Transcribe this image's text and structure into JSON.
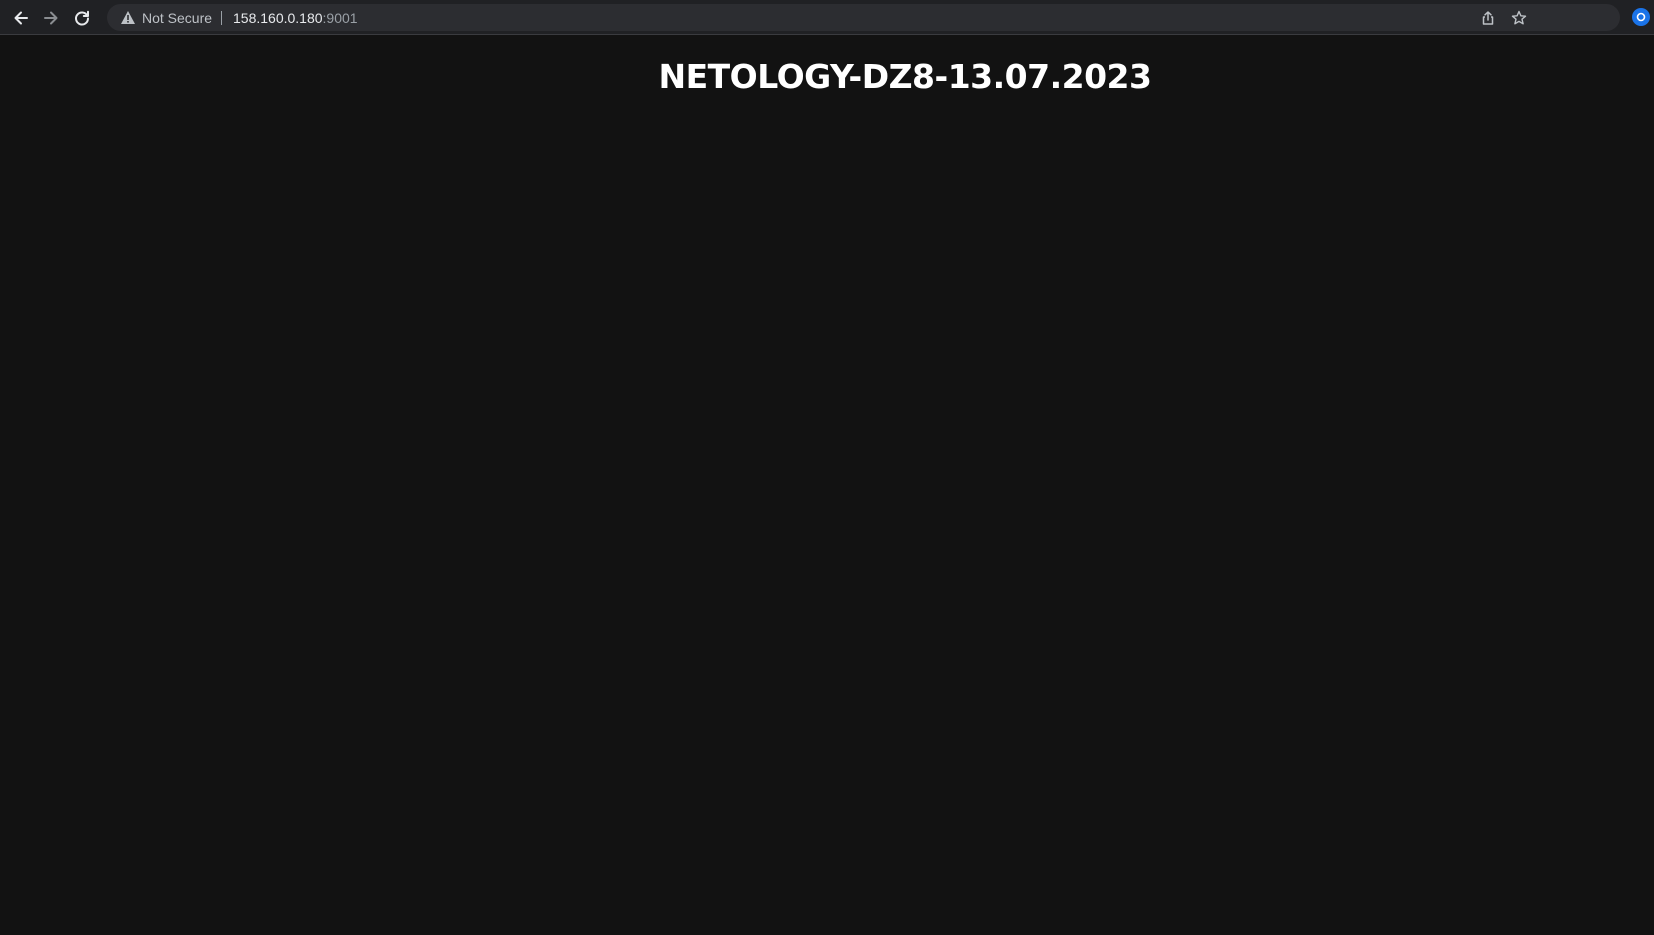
{
  "browser": {
    "security_label": "Not Secure",
    "url_host": "158.160.0.180",
    "url_port": ":9001",
    "icons": {
      "back": "arrow-left-icon",
      "forward": "arrow-right-icon",
      "reload": "reload-icon",
      "warning": "warning-triangle-icon",
      "share": "share-icon",
      "bookmark": "star-icon",
      "extension": "extension-icon"
    }
  },
  "page": {
    "heading": "NETOLOGY-DZ8-13.07.2023"
  },
  "colors": {
    "page_background": "#121212",
    "toolbar_background": "#202124",
    "heading_text": "#ffffff",
    "extension_accent": "#1a73e8"
  }
}
